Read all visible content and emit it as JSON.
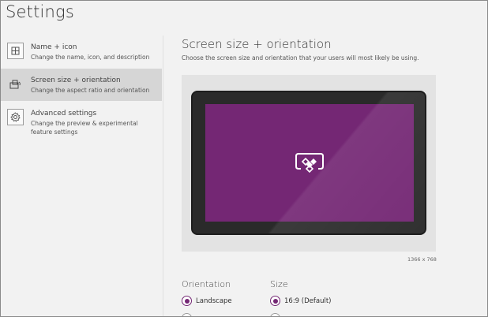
{
  "window": {
    "title": "Settings"
  },
  "sidebar": {
    "items": [
      {
        "label": "Name + icon",
        "description": "Change the name, icon, and description",
        "icon": "grid-icon",
        "active": false
      },
      {
        "label": "Screen size + orientation",
        "description": "Change the aspect ratio and orientation",
        "icon": "screen-orientation-icon",
        "active": true
      },
      {
        "label": "Advanced settings",
        "description": "Change the preview & experimental feature settings",
        "icon": "gear-icon",
        "active": false
      }
    ]
  },
  "main": {
    "title": "Screen size + orientation",
    "subtitle": "Choose the screen size and orientation that your users will most likely be using.",
    "preview": {
      "resolution": "1366 x 768",
      "screen_color": "#742774",
      "icon": "app-logo-icon"
    },
    "orientation": {
      "label": "Orientation",
      "options": [
        {
          "label": "Landscape",
          "selected": true
        }
      ]
    },
    "size": {
      "label": "Size",
      "options": [
        {
          "label": "16:9 (Default)",
          "selected": true
        }
      ]
    }
  },
  "colors": {
    "accent": "#742774",
    "sidebar_active": "#d6d6d6",
    "background": "#f2f2f2"
  }
}
